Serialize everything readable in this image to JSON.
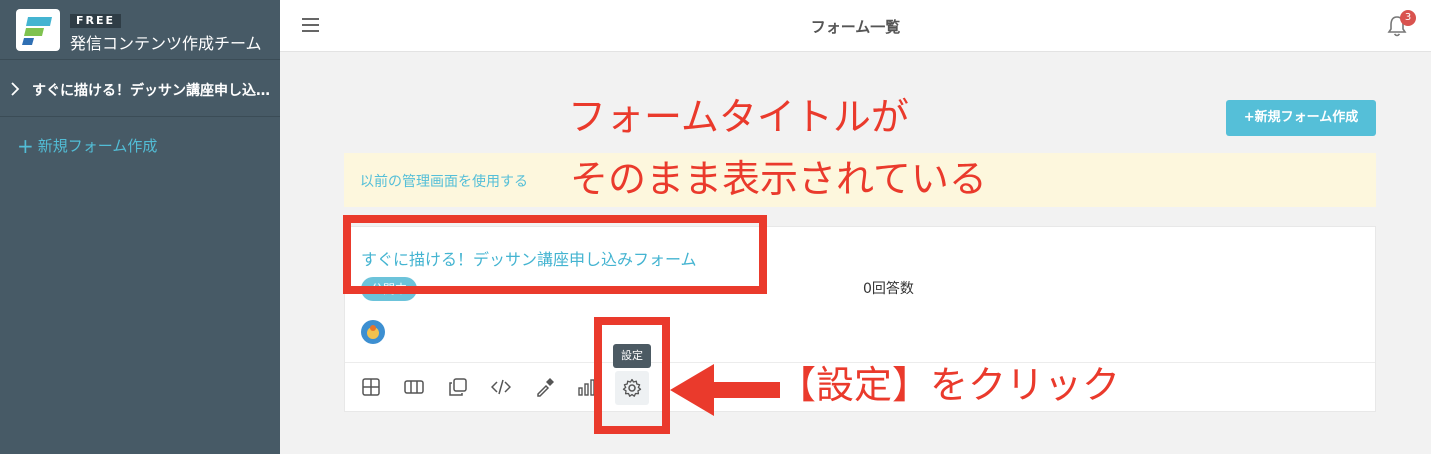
{
  "sidebar": {
    "plan_badge": "FREE",
    "team_name": "発信コンテンツ作成チーム",
    "form_item_label": "すぐに描ける！デッサン講座申し込みフォーム",
    "new_form_label": "新規フォーム作成"
  },
  "header": {
    "title": "フォーム一覧",
    "notification_count": "3"
  },
  "main": {
    "new_form_button": "+新規フォーム作成",
    "legacy_link": "以前の管理画面を使用する",
    "form_card": {
      "title": "すぐに描ける！デッサン講座申し込みフォーム",
      "status": "公開中",
      "response_count": "0回答数",
      "tooltip": "設定"
    }
  },
  "annotations": {
    "line1": "フォームタイトルが",
    "line2": "そのまま表示されている",
    "click_hint": "【設定】をクリック"
  },
  "colors": {
    "sidebar_bg": "#475a66",
    "accent": "#55bfd8",
    "annotation_red": "#ea3a2c",
    "banner_bg": "#fdf7dd"
  },
  "icons": [
    "hamburger-icon",
    "bell-icon",
    "chevron-right-icon",
    "plus-icon",
    "grid-icon",
    "columns-icon",
    "copy-icon",
    "code-icon",
    "eyedropper-icon",
    "bar-chart-icon",
    "gear-icon"
  ]
}
